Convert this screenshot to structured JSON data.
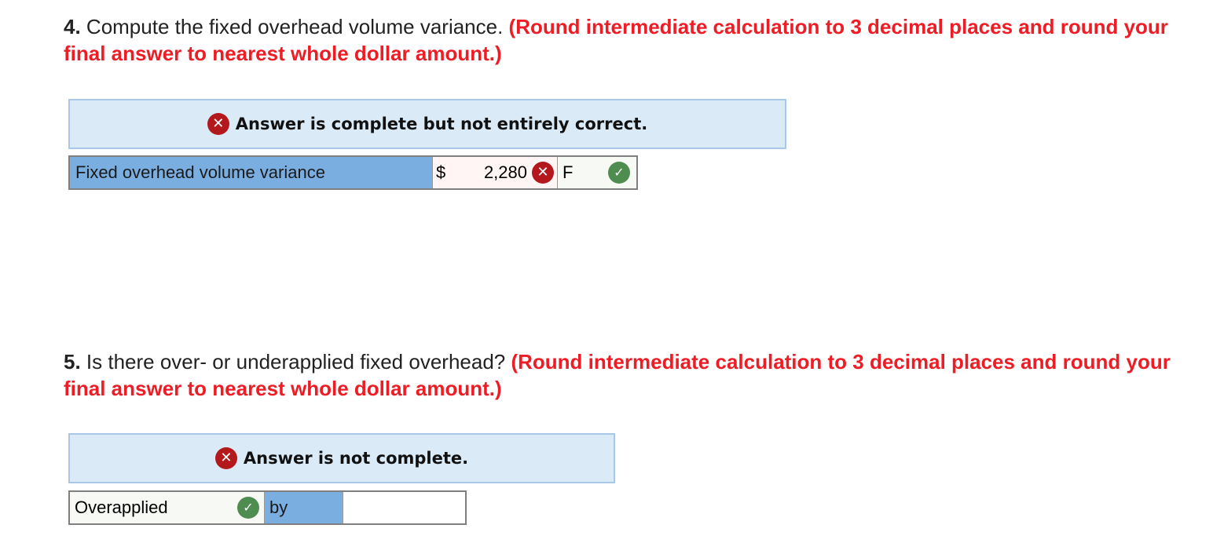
{
  "q4": {
    "number": "4.",
    "text": " Compute the fixed overhead volume variance. ",
    "instruction": "(Round intermediate calculation to 3 decimal places and round your final answer to nearest whole dollar amount.)",
    "banner": "Answer is complete but not entirely correct.",
    "row": {
      "label": "Fixed overhead volume variance",
      "currency": "$",
      "amount": "2,280",
      "amount_status": "incorrect",
      "type": "F",
      "type_status": "correct"
    }
  },
  "q5": {
    "number": "5.",
    "text": " Is there over- or underapplied fixed overhead? ",
    "instruction": "(Round intermediate calculation to 3 decimal places and round your final answer to nearest whole dollar amount.)",
    "banner": "Answer is not complete.",
    "row": {
      "selection": "Overapplied",
      "selection_status": "correct",
      "by_label": "by",
      "amount": ""
    }
  },
  "icons": {
    "incorrect": "✕",
    "correct": "✓"
  },
  "colors": {
    "instruction_red": "#ee1c25",
    "banner_bg": "#dbeaf7",
    "label_blue": "#7aaee0",
    "incorrect_red": "#b3181d",
    "correct_green": "#4f8c4f"
  }
}
